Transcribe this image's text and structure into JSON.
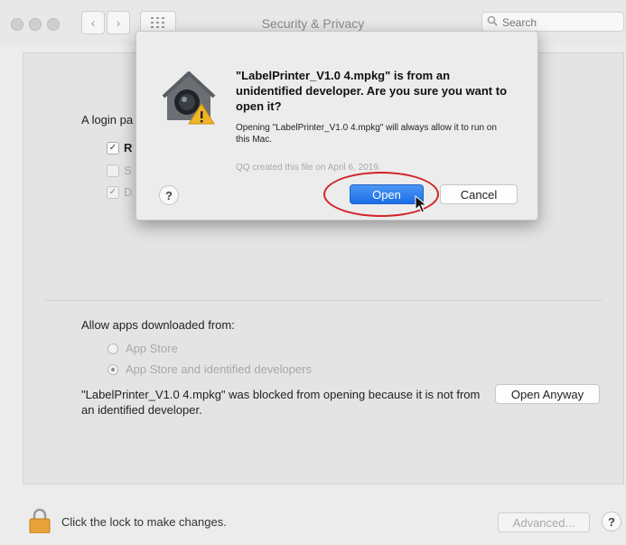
{
  "window": {
    "title": "Security & Privacy",
    "search_placeholder": "Search",
    "traffic_colors": [
      "#cfcfcf",
      "#cfcfcf",
      "#cfcfcf"
    ]
  },
  "general": {
    "login_label": "A login pa",
    "checkboxes": [
      {
        "label": "R",
        "checked": true,
        "enabled": true
      },
      {
        "label": "S",
        "checked": false,
        "enabled": false
      },
      {
        "label": "D",
        "checked": true,
        "enabled": false
      }
    ]
  },
  "allow": {
    "label": "Allow apps downloaded from:",
    "options": [
      {
        "label": "App Store",
        "selected": false
      },
      {
        "label": "App Store and identified developers",
        "selected": true
      }
    ],
    "blocked_message": "\"LabelPrinter_V1.0 4.mpkg\" was blocked from opening because it is not from an identified developer.",
    "open_anyway_label": "Open Anyway"
  },
  "footer": {
    "lock_text": "Click the lock to make changes.",
    "advanced_label": "Advanced...",
    "help_label": "?"
  },
  "dialog": {
    "title": "\"LabelPrinter_V1.0 4.mpkg\" is from an unidentified developer. Are you sure you want to open it?",
    "message": "Opening \"LabelPrinter_V1.0 4.mpkg\" will always allow it to run on this Mac.",
    "created": "QQ created this file on April 6, 2019.",
    "help_label": "?",
    "open_label": "Open",
    "cancel_label": "Cancel"
  },
  "colors": {
    "accent": "#1a6de7",
    "highlight": "#d1232a"
  }
}
